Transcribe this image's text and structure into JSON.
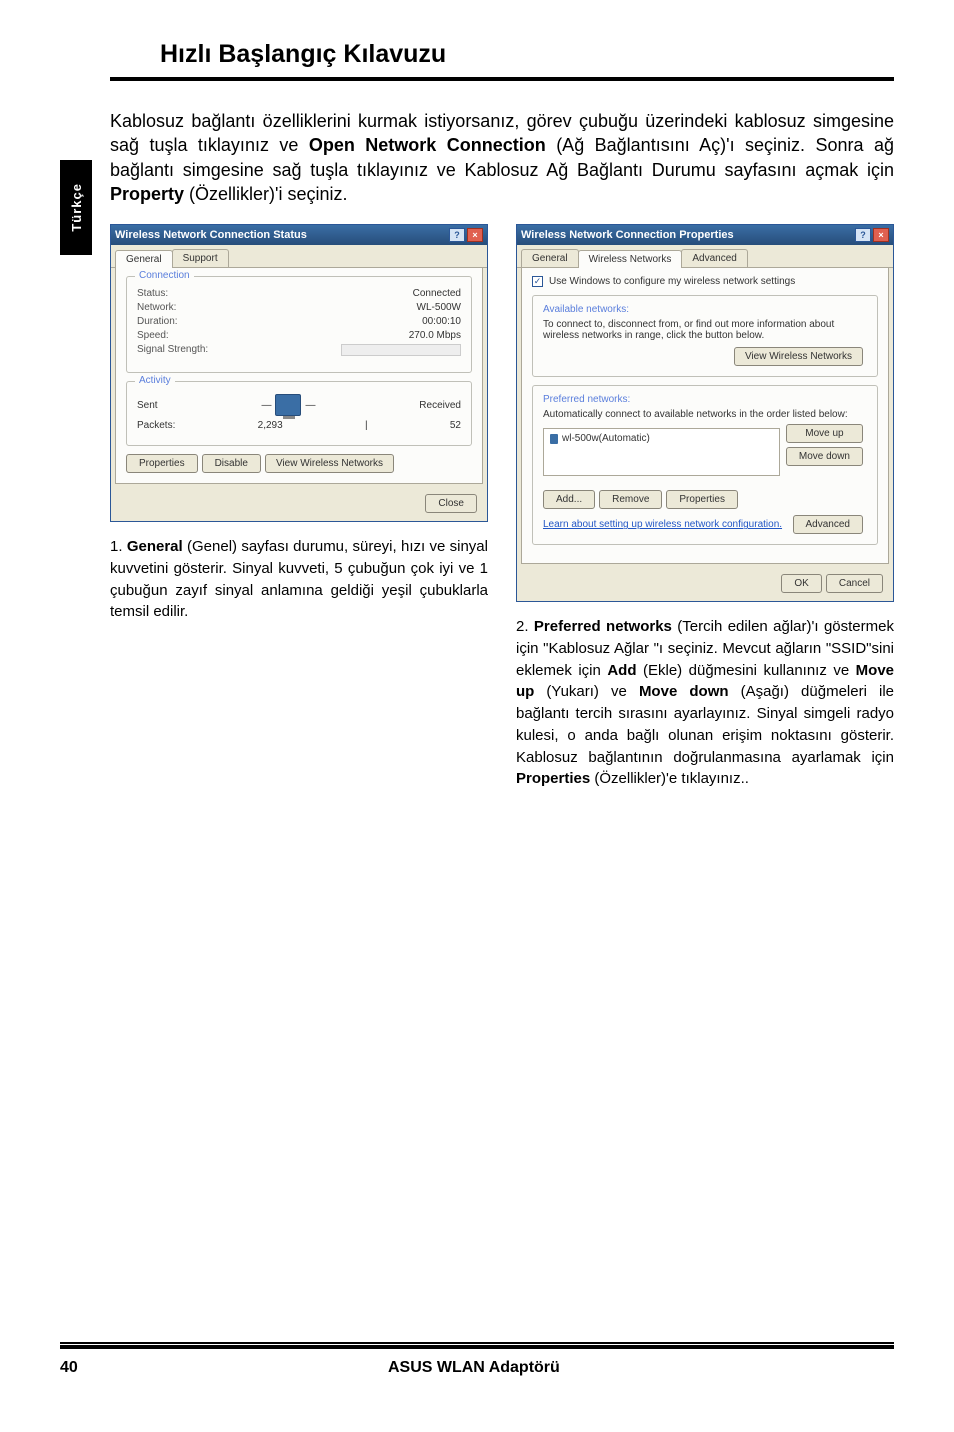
{
  "side_tab": "Türkçe",
  "header_title": "Hızlı Başlangıç Kılavuzu",
  "intro_parts": {
    "p1": "Kablosuz bağlantı özelliklerini kurmak istiyorsanız, görev çubuğu üzerindeki kablosuz simgesine sağ tuşla tıklayınız ve ",
    "b1": "Open Network Connection",
    "p2": " (Ağ Bağlantısını Aç)'ı seçiniz. Sonra ağ bağlantı simgesine sağ tuşla tıklayınız ve Kablosuz Ağ Bağlantı Durumu sayfasını açmak için ",
    "b2": "Property",
    "p3": " (Özellikler)'i seçiniz."
  },
  "win1": {
    "title": "Wireless Network Connection Status",
    "tabs": {
      "t1": "General",
      "t2": "Support"
    },
    "group_conn": "Connection",
    "status_k": "Status:",
    "status_v": "Connected",
    "network_k": "Network:",
    "network_v": "WL-500W",
    "duration_k": "Duration:",
    "duration_v": "00:00:10",
    "speed_k": "Speed:",
    "speed_v": "270.0 Mbps",
    "signal_k": "Signal Strength:",
    "group_act": "Activity",
    "sent": "Sent",
    "received": "Received",
    "packets_k": "Packets:",
    "packets_sent": "2,293",
    "packets_recv": "52",
    "btn_props": "Properties",
    "btn_disable": "Disable",
    "btn_view": "View Wireless Networks",
    "btn_close": "Close"
  },
  "win2": {
    "title": "Wireless Network Connection Properties",
    "tabs": {
      "t1": "General",
      "t2": "Wireless Networks",
      "t3": "Advanced"
    },
    "check_label": "Use Windows to configure my wireless network settings",
    "avail_title": "Available networks:",
    "avail_desc": "To connect to, disconnect from, or find out more information about wireless networks in range, click the button below.",
    "btn_view": "View Wireless Networks",
    "pref_title": "Preferred networks:",
    "pref_desc": "Automatically connect to available networks in the order listed below:",
    "list_item": "wl-500w(Automatic)",
    "btn_moveup": "Move up",
    "btn_movedown": "Move down",
    "btn_add": "Add...",
    "btn_remove": "Remove",
    "btn_props": "Properties",
    "link_text": "Learn about setting up wireless network configuration.",
    "btn_adv": "Advanced",
    "btn_ok": "OK",
    "btn_cancel": "Cancel"
  },
  "cap1": {
    "num": "1. ",
    "b1": "General",
    "rest": " (Genel) sayfası durumu, süreyi, hızı ve sinyal kuvvetini gösterir. Sinyal kuvveti, 5 çubuğun çok iyi ve 1 çubuğun zayıf sinyal anlamına geldiği yeşil çubuklarla temsil edilir."
  },
  "cap2": {
    "num": "2. ",
    "b1": "Preferred networks",
    "p1": " (Tercih edilen ağlar)'ı göstermek için \"Kablosuz Ağlar \"ı seçiniz. Mevcut ağların \"SSID\"sini eklemek için ",
    "b2": "Add",
    "p2": " (Ekle) düğmesini kullanınız ve ",
    "b3": "Move up",
    "p3": " (Yukarı) ve ",
    "b4": "Move down",
    "p4": " (Aşağı) düğmeleri ile bağlantı tercih sırasını ayarlayınız. Sinyal simgeli radyo kulesi, o anda bağlı olunan erişim noktasını gösterir. Kablosuz bağlantının doğrulanmasına ayarlamak için ",
    "b5": "Properties",
    "p5": " (Özellikler)'e tıklayınız.."
  },
  "footer": {
    "page": "40",
    "title": "ASUS WLAN Adaptörü"
  }
}
